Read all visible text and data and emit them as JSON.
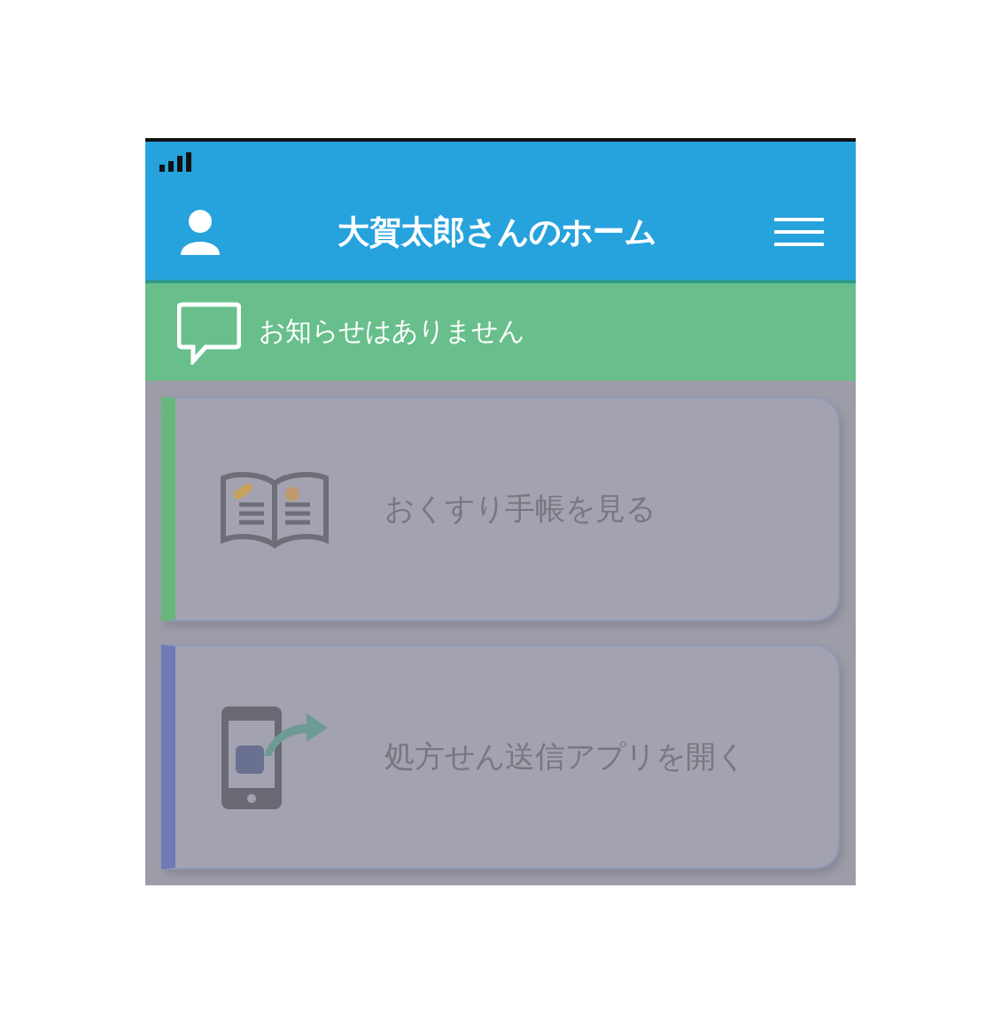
{
  "header": {
    "title": "大賀太郎さんのホーム"
  },
  "notice": {
    "text": "お知らせはありません"
  },
  "cards": [
    {
      "label": "おくすり手帳を見る",
      "kind": "notebook",
      "color": "#68b67a"
    },
    {
      "label": "処方せん送信アプリを開く",
      "kind": "phone",
      "color": "#6f7ab8"
    }
  ]
}
